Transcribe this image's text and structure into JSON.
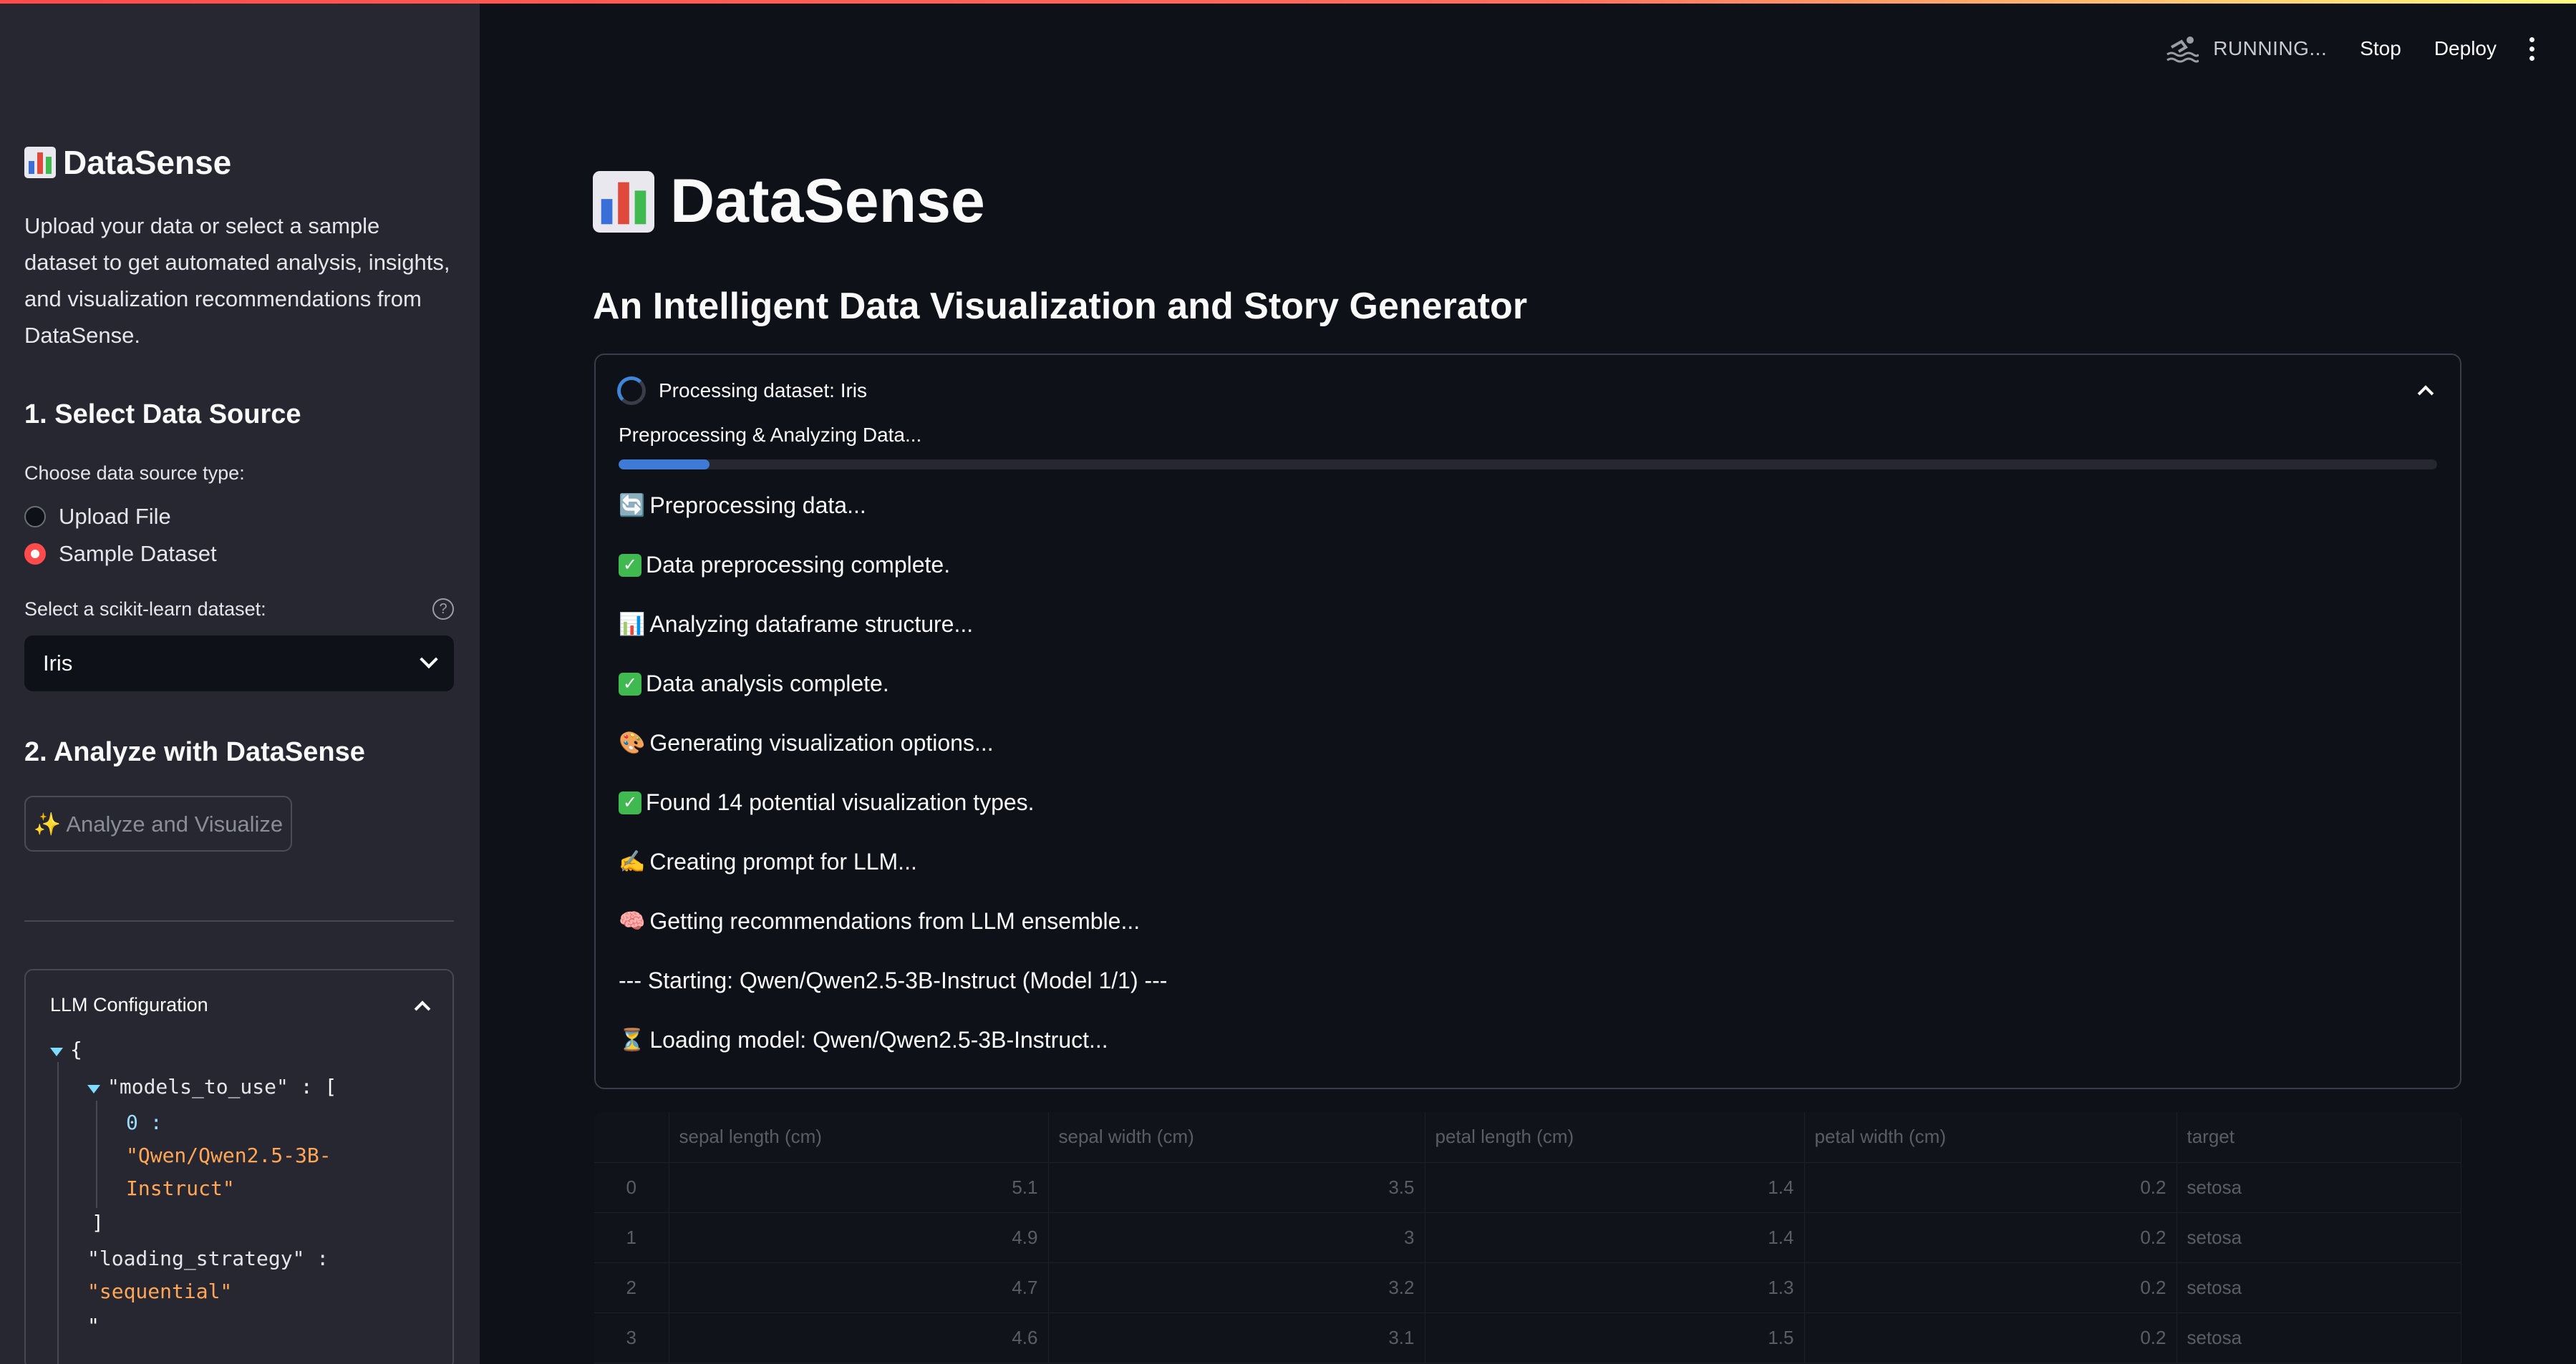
{
  "sidebar": {
    "title": "DataSense",
    "description": "Upload your data or select a sample dataset to get automated analysis, insights, and visualization recommendations from DataSense.",
    "section1_title": "1. Select Data Source",
    "source_type_label": "Choose data source type:",
    "radio_options": [
      "Upload File",
      "Sample Dataset"
    ],
    "selected_radio": "Sample Dataset",
    "dataset_label": "Select a scikit-learn dataset:",
    "dataset_selected": "Iris",
    "section2_title": "2. Analyze with DataSense",
    "analyze_button": "✨ Analyze and Visualize",
    "llm_config_title": "LLM Configuration",
    "json_lines": {
      "open_brace": "{",
      "models_key": "\"models_to_use\"",
      "colon_bracket": ": [",
      "idx0": "0 :",
      "model_str_1": "\"Qwen/Qwen2.5-3B-",
      "model_str_2": "Instruct\"",
      "close_bracket": "]",
      "loading_key": "\"loading_strategy\"",
      "colon": ":",
      "loading_val": "\"sequential\"",
      "next_quote": "\""
    }
  },
  "header": {
    "status": "RUNNING...",
    "stop": "Stop",
    "deploy": "Deploy"
  },
  "main": {
    "title": "DataSense",
    "subtitle": "An Intelligent Data Visualization and Story Generator",
    "status_title": "Processing dataset: Iris",
    "progress_label": "Preprocessing & Analyzing Data...",
    "progress_fraction": 0.05,
    "log": [
      {
        "icon": "🔄",
        "text": "Preprocessing data..."
      },
      {
        "icon": "✅",
        "text": "Data preprocessing complete."
      },
      {
        "icon": "📊",
        "text": "Analyzing dataframe structure..."
      },
      {
        "icon": "✅",
        "text": "Data analysis complete."
      },
      {
        "icon": "🎨",
        "text": "Generating visualization options..."
      },
      {
        "icon": "✅",
        "text": "Found 14 potential visualization types."
      },
      {
        "icon": "✍️",
        "text": "Creating prompt for LLM..."
      },
      {
        "icon": "🧠",
        "text": "Getting recommendations from LLM ensemble..."
      },
      {
        "icon": "",
        "text": "--- Starting: Qwen/Qwen2.5-3B-Instruct (Model 1/1) ---"
      },
      {
        "icon": "⏳",
        "text": "Loading model: Qwen/Qwen2.5-3B-Instruct..."
      }
    ]
  },
  "table": {
    "columns": [
      "",
      "sepal length (cm)",
      "sepal width (cm)",
      "petal length (cm)",
      "petal width (cm)",
      "target"
    ],
    "rows": [
      [
        "0",
        "5.1",
        "3.5",
        "1.4",
        "0.2",
        "setosa"
      ],
      [
        "1",
        "4.9",
        "3",
        "1.4",
        "0.2",
        "setosa"
      ],
      [
        "2",
        "4.7",
        "3.2",
        "1.3",
        "0.2",
        "setosa"
      ],
      [
        "3",
        "4.6",
        "3.1",
        "1.5",
        "0.2",
        "setosa"
      ]
    ]
  },
  "colors": {
    "accent": "#ff4b4b",
    "progress": "#3f7ad6",
    "background": "#0e1117",
    "sidebar": "#262730"
  }
}
